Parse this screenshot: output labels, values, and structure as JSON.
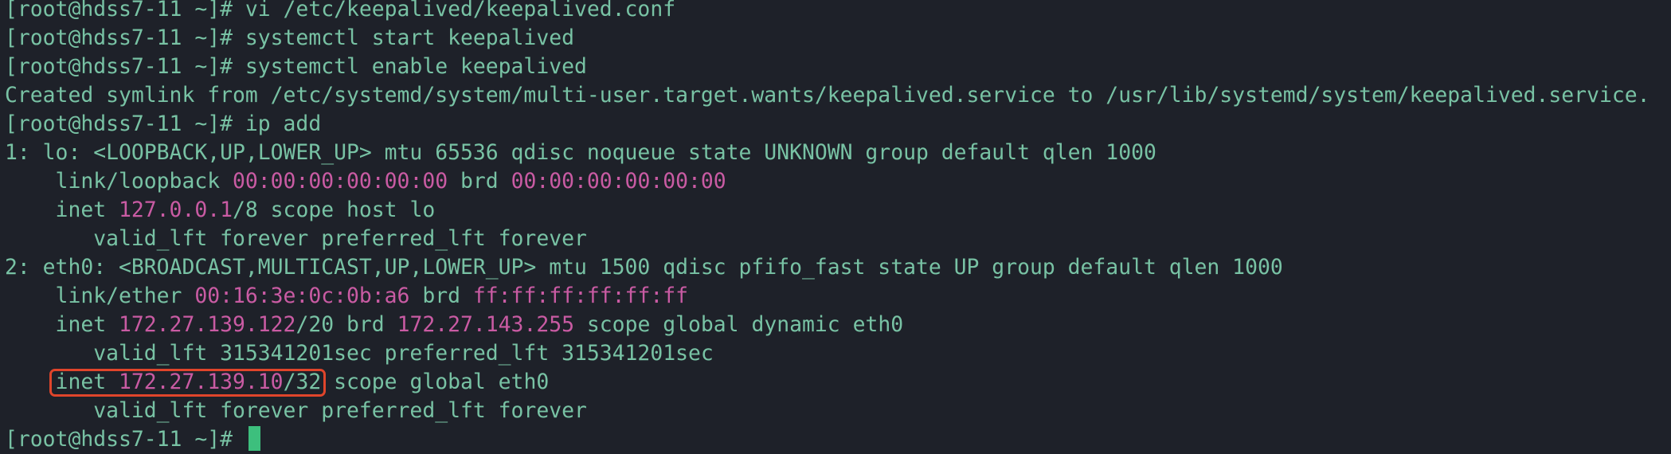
{
  "terminal": {
    "lines": [
      {
        "seg": [
          "[root@hdss7-11 ~]# vi /etc/keepalived/keepalived.conf"
        ]
      },
      {
        "seg": [
          "[root@hdss7-11 ~]# systemctl start keepalived"
        ]
      },
      {
        "seg": [
          "[root@hdss7-11 ~]# systemctl enable keepalived"
        ]
      },
      {
        "seg": [
          "Created symlink from /etc/systemd/system/multi-user.target.wants/keepalived.service to /usr/lib/systemd/system/keepalived.service."
        ]
      },
      {
        "seg": [
          "[root@hdss7-11 ~]# ip add"
        ]
      },
      {
        "seg": [
          "1: lo: <LOOPBACK,UP,LOWER_UP> mtu 65536 qdisc noqueue state UNKNOWN group default qlen 1000"
        ]
      },
      {
        "seg": [
          "    link/loopback ",
          "00:00:00:00:00:00",
          " brd ",
          "00:00:00:00:00:00"
        ]
      },
      {
        "seg": [
          "    inet ",
          "127.0.0.1",
          "/8 scope host lo"
        ]
      },
      {
        "seg": [
          "       valid_lft forever preferred_lft forever"
        ]
      },
      {
        "seg": [
          "2: eth0: <BROADCAST,MULTICAST,UP,LOWER_UP> mtu 1500 qdisc pfifo_fast state UP group default qlen 1000"
        ]
      },
      {
        "seg": [
          "    link/ether ",
          "00:16:3e:0c:0b:a6",
          " brd ",
          "ff:ff:ff:ff:ff:ff"
        ]
      },
      {
        "seg": [
          "    inet ",
          "172.27.139.122",
          "/20 brd ",
          "172.27.143.255",
          " scope global dynamic eth0"
        ]
      },
      {
        "seg": [
          "       valid_lft 315341201sec preferred_lft 315341201sec"
        ]
      },
      {
        "seg": [
          "    inet ",
          "172.27.139.10",
          "/32 scope global eth0"
        ]
      },
      {
        "seg": [
          "       valid_lft forever preferred_lft forever"
        ]
      },
      {
        "seg": [
          "[root@hdss7-11 ~]# "
        ]
      }
    ]
  },
  "colors": {
    "background": "#1e2129",
    "text": "#78c2a4",
    "address": "#c95ba3",
    "highlight_border": "#e0452b",
    "cursor": "#3dbf7d"
  }
}
